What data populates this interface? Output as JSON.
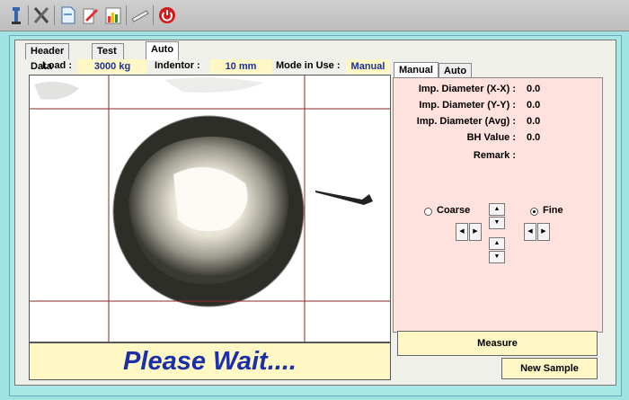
{
  "tabs": [
    "Header Data",
    "Test Data",
    "Auto"
  ],
  "info": {
    "load_label": "Load :",
    "load_value": "3000 kg",
    "indentor_label": "Indentor :",
    "indentor_value": "10 mm",
    "mode_label": "Mode in Use :",
    "mode_value": "Manual"
  },
  "right_tabs": [
    "Manual",
    "Auto"
  ],
  "results": [
    {
      "label": "Imp. Diameter (X-X) :",
      "value": "0.0"
    },
    {
      "label": "Imp. Diameter (Y-Y) :",
      "value": "0.0"
    },
    {
      "label": "Imp. Diameter (Avg) :",
      "value": "0.0"
    },
    {
      "label": "BH Value :",
      "value": "0.0"
    },
    {
      "label": "Remark :",
      "value": ""
    }
  ],
  "options": {
    "coarse": "Coarse",
    "fine": "Fine",
    "selected": "Fine"
  },
  "status": "Please Wait....",
  "buttons": {
    "measure": "Measure",
    "new_sample": "New Sample"
  },
  "icons": [
    "gauge-icon",
    "tools-icon",
    "document-icon",
    "edit-icon",
    "report-icon",
    "ruler-icon",
    "power-icon"
  ],
  "colors": {
    "value_text": "#1a2f9c",
    "field_bg": "#fff8c4",
    "result_bg": "#ffe1dd",
    "frame_bg": "#a9e6e6"
  }
}
